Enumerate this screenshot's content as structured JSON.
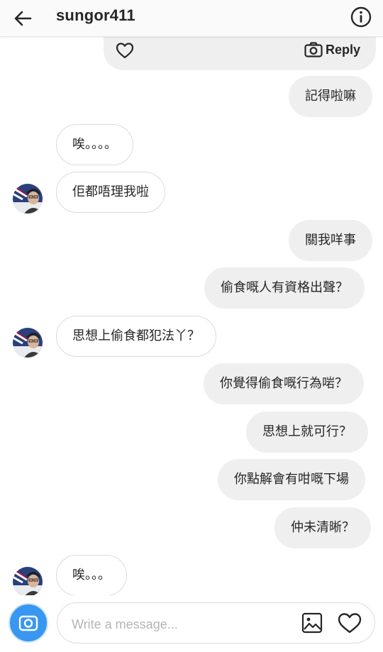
{
  "header": {
    "title": "sungor411",
    "back_icon": "arrow-left-icon",
    "info_icon": "info-icon"
  },
  "top_message": {
    "reply_label": "Reply",
    "heart_icon": "heart-outline-icon",
    "camera_icon": "camera-icon"
  },
  "messages": [
    {
      "side": "out",
      "text": "記得啦嘛"
    },
    {
      "side": "in",
      "text": "唉。。。。"
    },
    {
      "side": "in",
      "text": "佢都唔理我啦"
    },
    {
      "side": "out",
      "text": "關我咩事"
    },
    {
      "side": "out",
      "text": "偷食嘅人有資格出聲？"
    },
    {
      "side": "in",
      "text": "思想上偷食都犯法丫？"
    },
    {
      "side": "out",
      "text": "你覺得偷食嘅行為啱？"
    },
    {
      "side": "out",
      "text": "思想上就可行？"
    },
    {
      "side": "out",
      "text": "你點解會有咁嘅下場"
    },
    {
      "side": "out",
      "text": "仲未清晰？"
    },
    {
      "side": "in",
      "text": "唉。。。"
    }
  ],
  "composer": {
    "placeholder": "Write a message...",
    "camera_icon": "camera-icon",
    "gallery_icon": "image-icon",
    "like_icon": "heart-outline-icon"
  },
  "colors": {
    "accent": "#3897f0",
    "bubble_out": "#efefef",
    "bubble_in_border": "#dbdbdb",
    "text": "#262626"
  }
}
